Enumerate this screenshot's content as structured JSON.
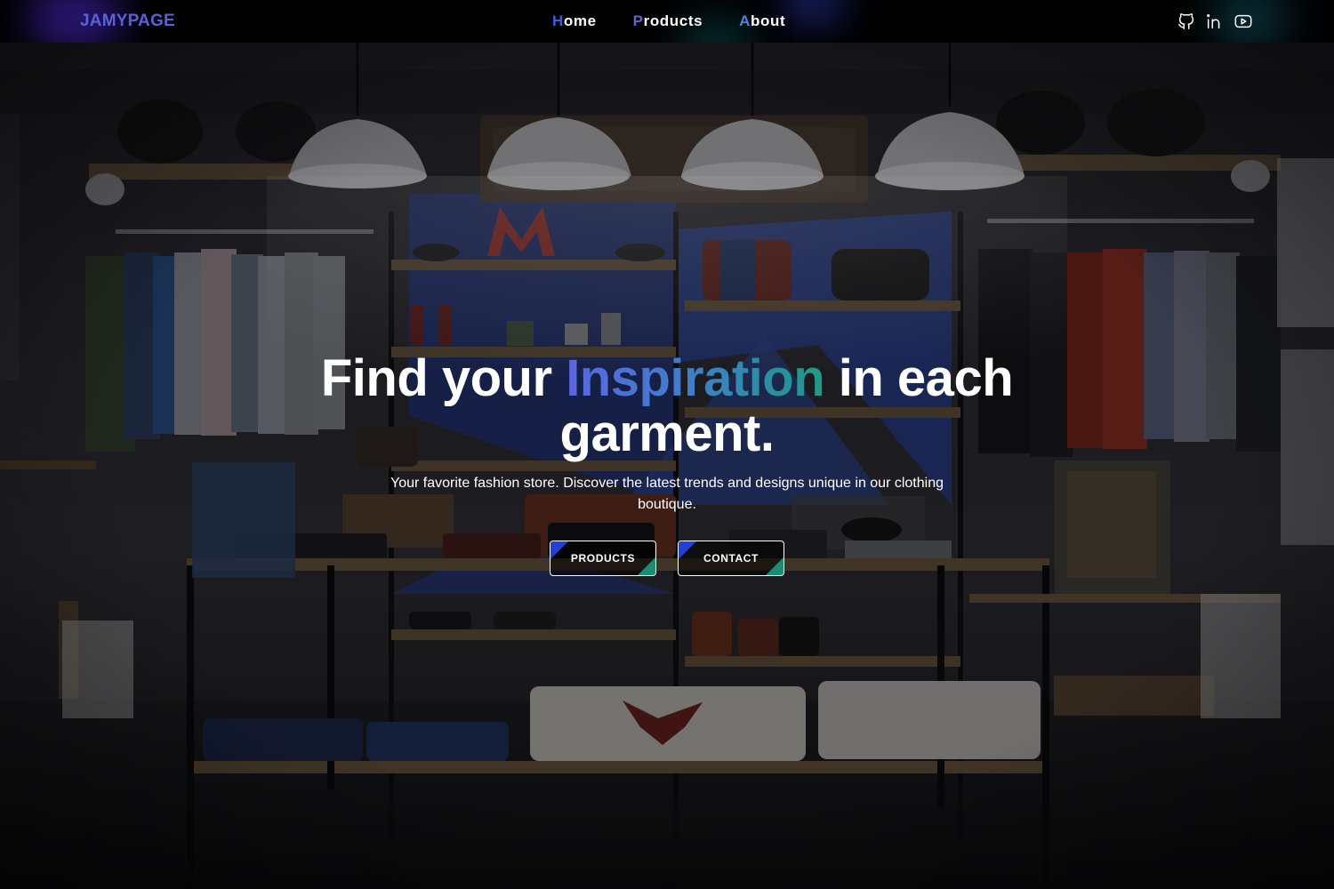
{
  "header": {
    "logo": "JAMYPAGE",
    "nav": [
      {
        "first": "H",
        "rest": "ome"
      },
      {
        "first": "P",
        "rest": "roducts"
      },
      {
        "first": "A",
        "rest": "bout"
      }
    ],
    "socials": [
      "github-icon",
      "linkedin-icon",
      "youtube-icon"
    ]
  },
  "hero": {
    "headline_before": "Find your ",
    "headline_accent": "Inspiration",
    "headline_after": " in each garment.",
    "subtitle": "Your favorite fashion store. Discover the latest trends and designs unique in our clothing boutique.",
    "buttons": {
      "products": "PRODUCTS",
      "contact": "CONTACT"
    },
    "background": "clothing-store-photo"
  },
  "colors": {
    "logo": "#5a60d8",
    "accent_start": "#5a66e0",
    "accent_end": "#1f9a84",
    "button_corner_blue": "#2240d6",
    "button_corner_green": "#188f74"
  }
}
